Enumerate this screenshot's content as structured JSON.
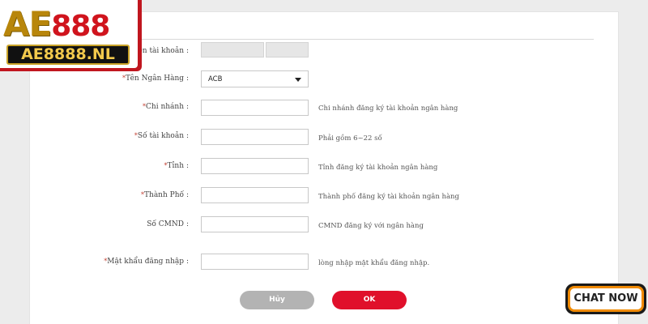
{
  "form": {
    "rows": [
      {
        "key": "account_name",
        "label": "Tên tài khoản",
        "required": false,
        "hint": ""
      },
      {
        "key": "bank_name",
        "label": "Tên Ngân Hàng",
        "required": true,
        "hint": ""
      },
      {
        "key": "branch",
        "label": "Chi nhánh",
        "required": true,
        "hint": "Chi nhánh đăng ký tài khoản ngân hàng"
      },
      {
        "key": "account_number",
        "label": "Số tài khoản",
        "required": true,
        "hint": "Phải gồm 6~22 số"
      },
      {
        "key": "province",
        "label": "Tỉnh",
        "required": true,
        "hint": "Tỉnh đăng ký tài khoản ngân hàng"
      },
      {
        "key": "city",
        "label": "Thành Phố",
        "required": true,
        "hint": "Thành phố đăng ký tài khoản ngân hàng"
      },
      {
        "key": "id_card",
        "label": "Số CMND",
        "required": false,
        "hint": "CMND đăng ký với ngân hàng"
      },
      {
        "key": "login_password",
        "label": "Mật khẩu đăng nhập",
        "required": true,
        "hint": "lòng nhập mật khẩu đăng nhập."
      }
    ],
    "bank_selected": "ACB",
    "colon": ":",
    "required_mark": "*",
    "cancel_label": "Hủy",
    "ok_label": "OK"
  },
  "logo": {
    "brand_letters": "AE",
    "brand_number": "888",
    "url": "AE8888.NL"
  },
  "chat": {
    "label": "CHAT NOW"
  },
  "colors": {
    "ok_button": "#e0102b",
    "cancel_button": "#b3b3b3",
    "required_star": "#c0392b",
    "logo_red": "#c0161f",
    "chat_border": "#f08a00"
  }
}
